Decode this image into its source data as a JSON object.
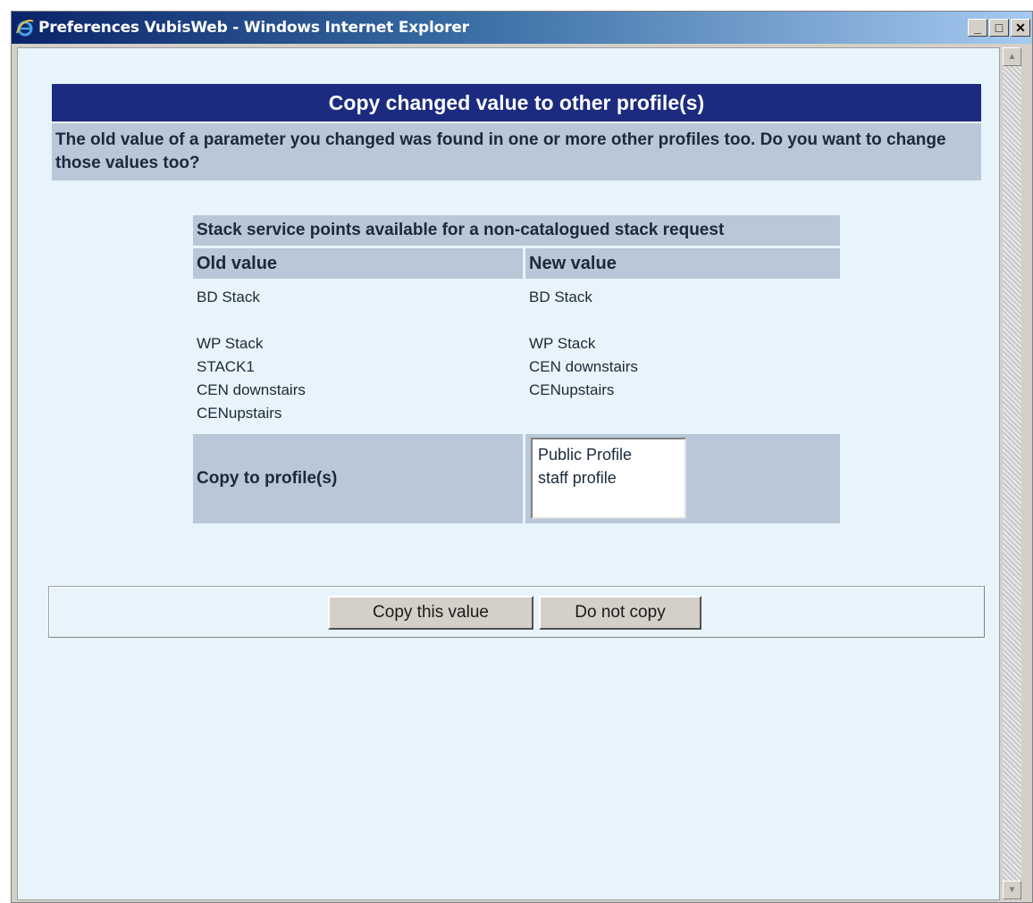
{
  "window": {
    "title": "Preferences VubisWeb - Windows Internet Explorer",
    "buttons": {
      "minimize": "_",
      "maximize": "□",
      "close": "✕"
    }
  },
  "page": {
    "header": "Copy changed value to other profile(s)",
    "intro": "The old value of a parameter you changed was found in one or more other profiles too. Do you want to change those values too?"
  },
  "table": {
    "title": "Stack service points available for a non-catalogued stack request",
    "old_header": "Old value",
    "new_header": "New value",
    "old_values": [
      "BD Stack",
      "",
      "WP Stack",
      "STACK1",
      "CEN downstairs",
      "CENupstairs"
    ],
    "new_values": [
      "BD Stack",
      "",
      "WP Stack",
      "CEN downstairs",
      "CENupstairs"
    ],
    "copy_label": "Copy to profile(s)",
    "profiles": [
      "Public Profile",
      "staff profile"
    ]
  },
  "actions": {
    "copy": "Copy this value",
    "do_not_copy": "Do not copy"
  },
  "colors": {
    "header_bg": "#1c2b80",
    "cell_bg": "#b8c8d8",
    "page_bg": "#e8f4fc"
  }
}
